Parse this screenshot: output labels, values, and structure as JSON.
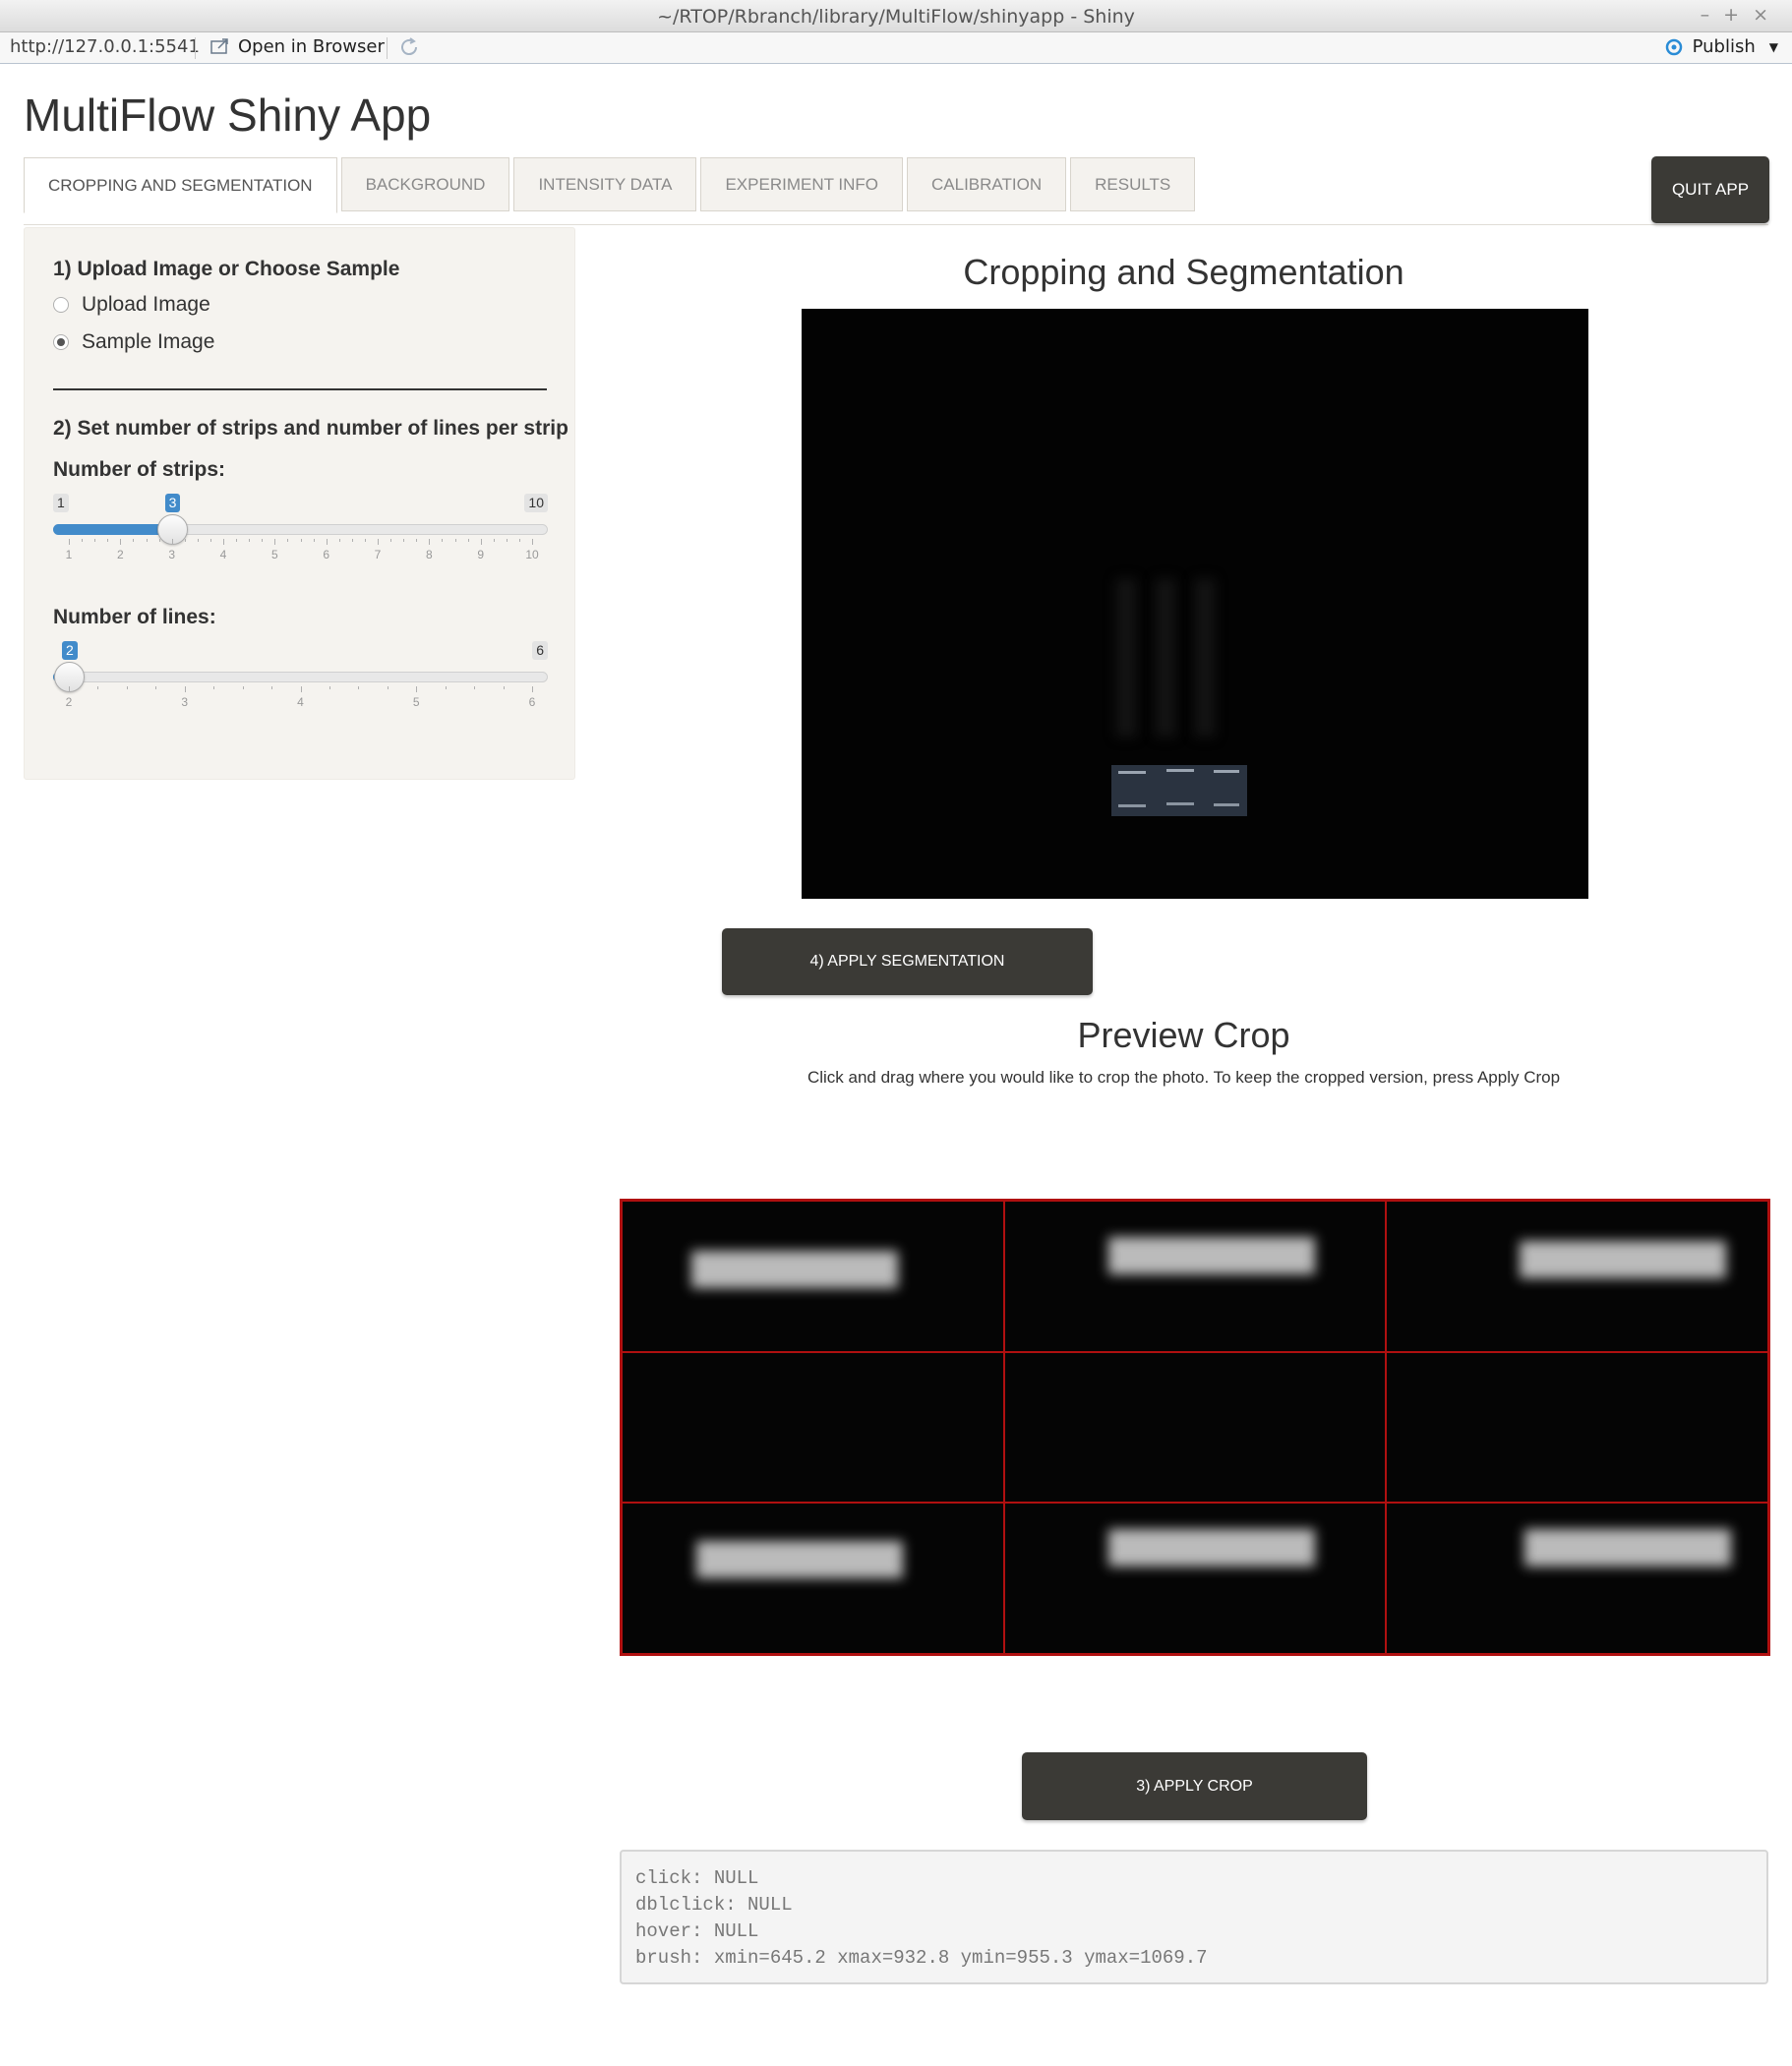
{
  "window": {
    "title": "~/RTOP/Rbranch/library/MultiFlow/shinyapp - Shiny",
    "url": "http://127.0.0.1:5541",
    "open_in_browser": "Open in Browser",
    "publish": "Publish"
  },
  "app": {
    "title": "MultiFlow Shiny App",
    "tabs": [
      {
        "label": "CROPPING AND SEGMENTATION",
        "active": true
      },
      {
        "label": "BACKGROUND"
      },
      {
        "label": "INTENSITY DATA"
      },
      {
        "label": "EXPERIMENT INFO"
      },
      {
        "label": "CALIBRATION"
      },
      {
        "label": "RESULTS"
      }
    ],
    "quit_label": "QUIT APP"
  },
  "sidebar": {
    "step1_heading": "1) Upload Image or Choose Sample",
    "radio_options": [
      {
        "label": "Upload Image",
        "checked": false
      },
      {
        "label": "Sample Image",
        "checked": true
      }
    ],
    "step2_heading": "2) Set number of strips and number of lines per strip",
    "strips": {
      "label": "Number of strips:",
      "min": 1,
      "max": 10,
      "value": 3,
      "min_text": "1",
      "max_text": "10",
      "value_text": "3",
      "ticks": [
        "1",
        "2",
        "3",
        "4",
        "5",
        "6",
        "7",
        "8",
        "9",
        "10"
      ]
    },
    "lines": {
      "label": "Number of lines:",
      "min": 2,
      "max": 6,
      "value": 2,
      "min_text": "2",
      "max_text": "6",
      "value_text": "2",
      "ticks": [
        "2",
        "3",
        "4",
        "5",
        "6"
      ]
    }
  },
  "main": {
    "segmentation_title": "Cropping and Segmentation",
    "apply_segmentation": "4) APPLY SEGMENTATION",
    "preview_title": "Preview Crop",
    "instructions": "Click and drag where you would like to crop the photo. To keep the cropped version, press Apply Crop",
    "apply_crop": "3) APPLY CROP",
    "console_lines": [
      "click: NULL",
      "dblclick: NULL",
      "hover: NULL",
      "brush: xmin=645.2 xmax=932.8 ymin=955.3 ymax=1069.7"
    ]
  },
  "colors": {
    "accent": "#428bca",
    "button_dark": "#3b3a36",
    "grid_red": "#b01010"
  }
}
